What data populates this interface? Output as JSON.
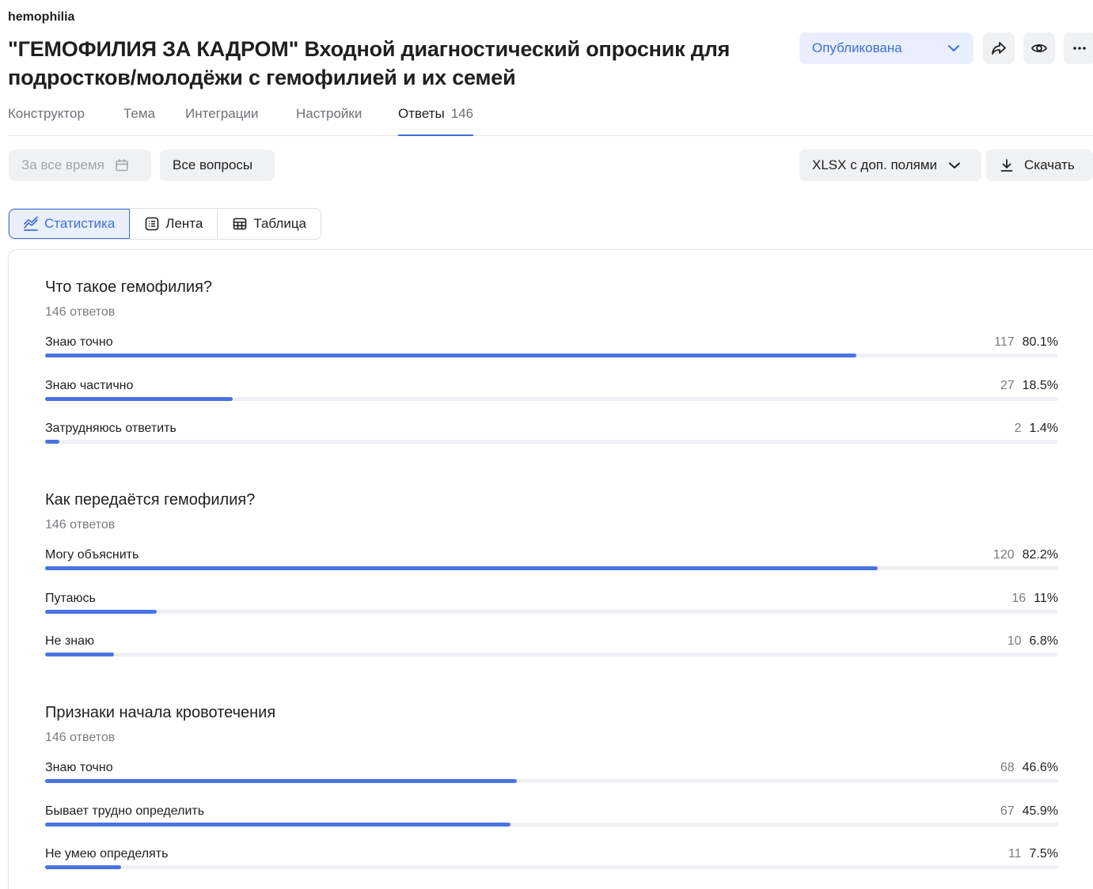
{
  "header": {
    "workspace": "hemophilia",
    "title": "\"ГЕМОФИЛИЯ ЗА КАДРОМ\" Входной диагностический опросник для подростков/молодёжи с гемофилией и их семей",
    "status": "Опубликована"
  },
  "tabs": [
    {
      "label": "Конструктор"
    },
    {
      "label": "Тема"
    },
    {
      "label": "Интеграции"
    },
    {
      "label": "Настройки"
    },
    {
      "label": "Ответы",
      "count": "146",
      "active": true
    }
  ],
  "filters": {
    "period": "За все время",
    "questions": "Все вопросы",
    "export_format": "XLSX с доп. полями",
    "download": "Скачать"
  },
  "views": {
    "stats": "Статистика",
    "feed": "Лента",
    "table": "Таблица"
  },
  "questions": [
    {
      "title": "Что такое гемофилия?",
      "count_label": "146 ответов",
      "options": [
        {
          "label": "Знаю точно",
          "count": "117",
          "percent": "80.1%",
          "share": 80.1
        },
        {
          "label": "Знаю частично",
          "count": "27",
          "percent": "18.5%",
          "share": 18.5
        },
        {
          "label": "Затрудняюсь ответить",
          "count": "2",
          "percent": "1.4%",
          "share": 1.4
        }
      ]
    },
    {
      "title": "Как передаётся гемофилия?",
      "count_label": "146 ответов",
      "options": [
        {
          "label": "Могу объяснить",
          "count": "120",
          "percent": "82.2%",
          "share": 82.2
        },
        {
          "label": "Путаюсь",
          "count": "16",
          "percent": "11%",
          "share": 11
        },
        {
          "label": "Не знаю",
          "count": "10",
          "percent": "6.8%",
          "share": 6.8
        }
      ]
    },
    {
      "title": "Признаки начала кровотечения",
      "count_label": "146 ответов",
      "options": [
        {
          "label": "Знаю точно",
          "count": "68",
          "percent": "46.6%",
          "share": 46.6
        },
        {
          "label": "Бывает трудно определить",
          "count": "67",
          "percent": "45.9%",
          "share": 45.9
        },
        {
          "label": "Не умею определять",
          "count": "11",
          "percent": "7.5%",
          "share": 7.5
        }
      ]
    }
  ],
  "colors": {
    "accent": "#3f6fd8",
    "bar_fill": "#4a73e0",
    "bar_track": "#eef0f3"
  },
  "icons": {
    "status": "chevron-down-icon",
    "share": "share-icon",
    "preview": "eye-icon",
    "more": "more-icon",
    "period": "calendar-icon",
    "export": "chevron-down-icon",
    "download": "download-icon",
    "stats_view": "chart-icon",
    "feed_view": "list-icon",
    "table_view": "table-icon"
  }
}
